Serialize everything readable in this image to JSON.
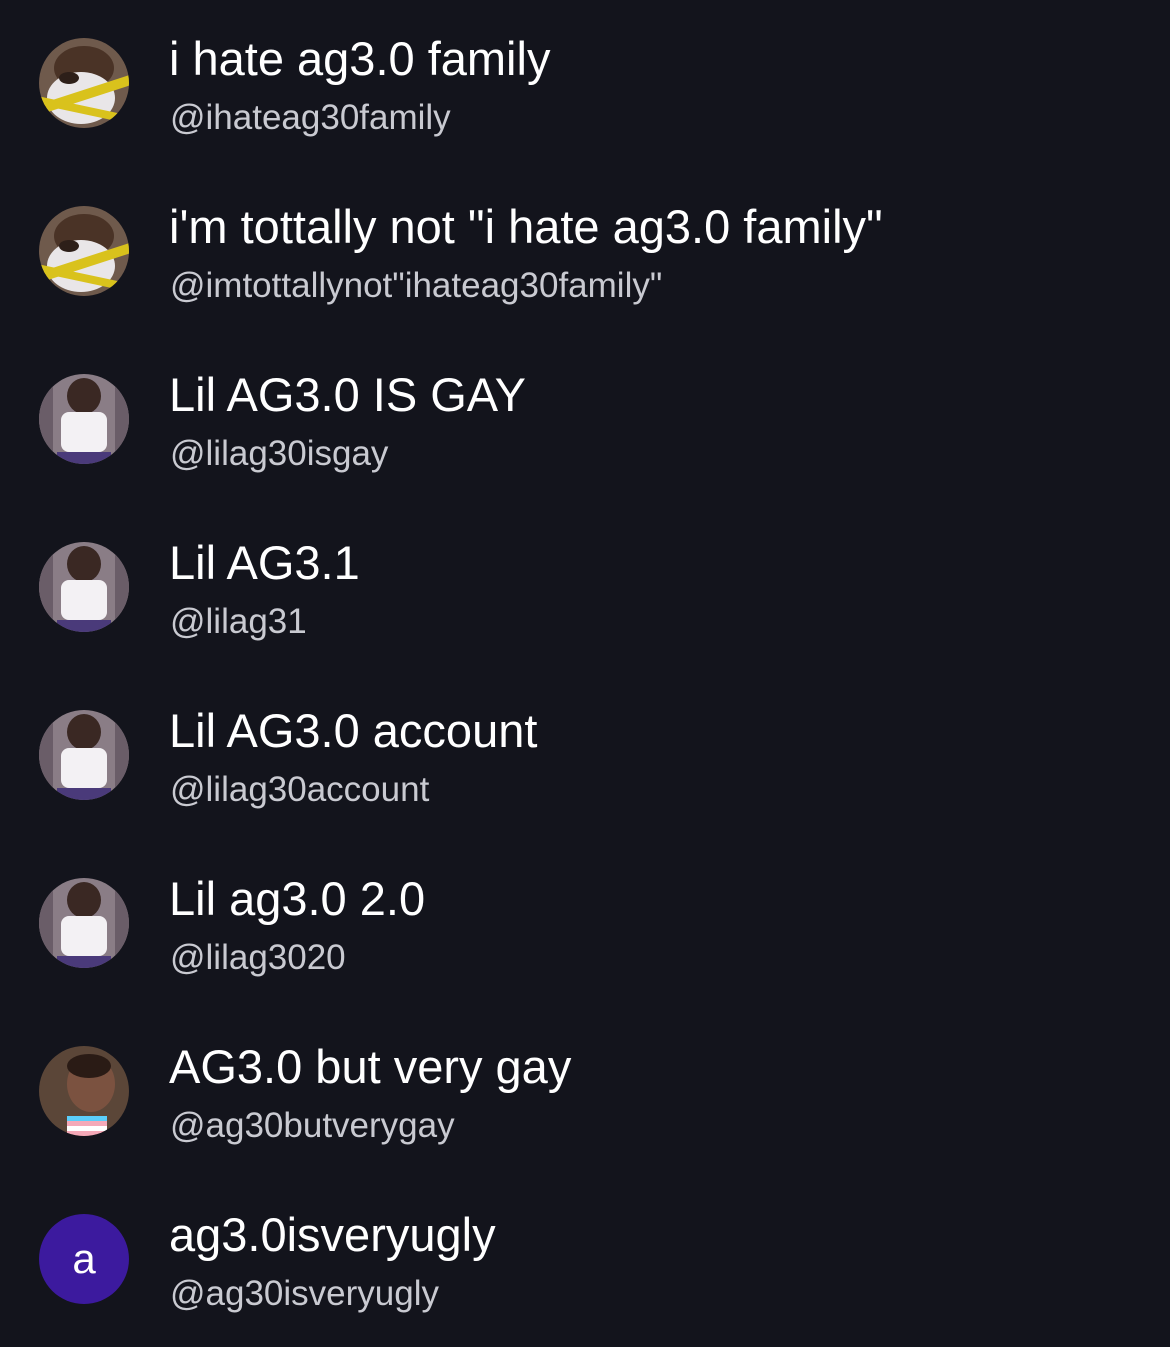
{
  "colors": {
    "background": "#13141c",
    "name_text": "#ffffff",
    "handle_text": "#c9cad1",
    "letter_avatar_bg": "#3c1a9e"
  },
  "accounts": [
    {
      "display_name": "i hate ag3.0 family",
      "handle": "@ihateag30family",
      "avatar": "photo-avatar-caution-tape"
    },
    {
      "display_name": "i'm tottally not \"i hate ag3.0 family\"",
      "handle": "@imtottallynot\"ihateag30family\"",
      "avatar": "photo-avatar-caution-tape"
    },
    {
      "display_name": "Lil AG3.0 IS GAY",
      "handle": "@lilag30isgay",
      "avatar": "photo-avatar-child"
    },
    {
      "display_name": "Lil AG3.1",
      "handle": "@lilag31",
      "avatar": "photo-avatar-child"
    },
    {
      "display_name": "Lil AG3.0 account",
      "handle": "@lilag30account",
      "avatar": "photo-avatar-child"
    },
    {
      "display_name": "Lil ag3.0 2.0",
      "handle": "@lilag3020",
      "avatar": "photo-avatar-child"
    },
    {
      "display_name": "AG3.0 but very gay",
      "handle": "@ag30butverygay",
      "avatar": "photo-avatar-flag"
    },
    {
      "display_name": "ag3.0isveryugly",
      "handle": "@ag30isveryugly",
      "avatar": "letter-avatar",
      "avatar_letter": "a"
    }
  ]
}
